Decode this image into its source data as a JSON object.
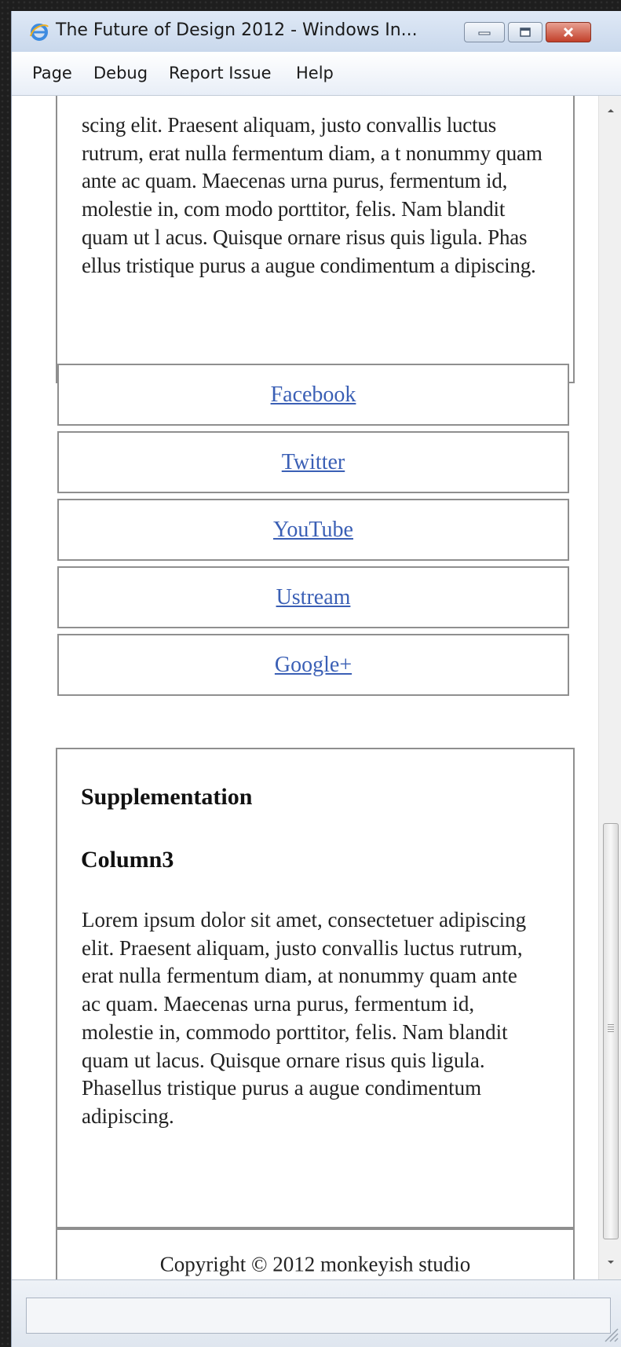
{
  "window": {
    "title": "The Future of Design 2012 - Windows In...",
    "icon": "ie-icon"
  },
  "menu": {
    "items": [
      "Page",
      "Debug",
      "Report Issue",
      "Help"
    ]
  },
  "content": {
    "main_text": "scing elit. Praesent aliquam, justo convallis luctus rutrum, erat nulla fermentum diam, a t nonummy quam ante ac quam. Maecenas urna purus, fermentum id, molestie in, com modo porttitor, felis. Nam blandit quam ut l acus. Quisque ornare risus quis ligula. Phas ellus tristique purus a augue condimentum a dipiscing.",
    "links": [
      "Facebook",
      "Twitter",
      "YouTube",
      "Ustream",
      "Google+"
    ],
    "supplementation": {
      "heading": "Supplementation",
      "subheading": "Column3",
      "text": "Lorem ipsum dolor sit amet, consectetuer adipiscing elit. Praesent aliquam, justo convallis luctus rutrum, erat nulla fermentum diam, at nonummy quam ante ac quam. Maecenas urna purus, fermentum id, molestie in, commodo porttitor, felis. Nam blandit quam ut lacus. Quisque ornare risus quis ligula. Phasellus tristique purus a augue condimentum adipiscing."
    },
    "copyright": "Copyright © 2012 monkeyish studio"
  },
  "colors": {
    "link": "#3a5fb5",
    "box_border": "#8f8f8f",
    "close_button": "#c2402a"
  }
}
